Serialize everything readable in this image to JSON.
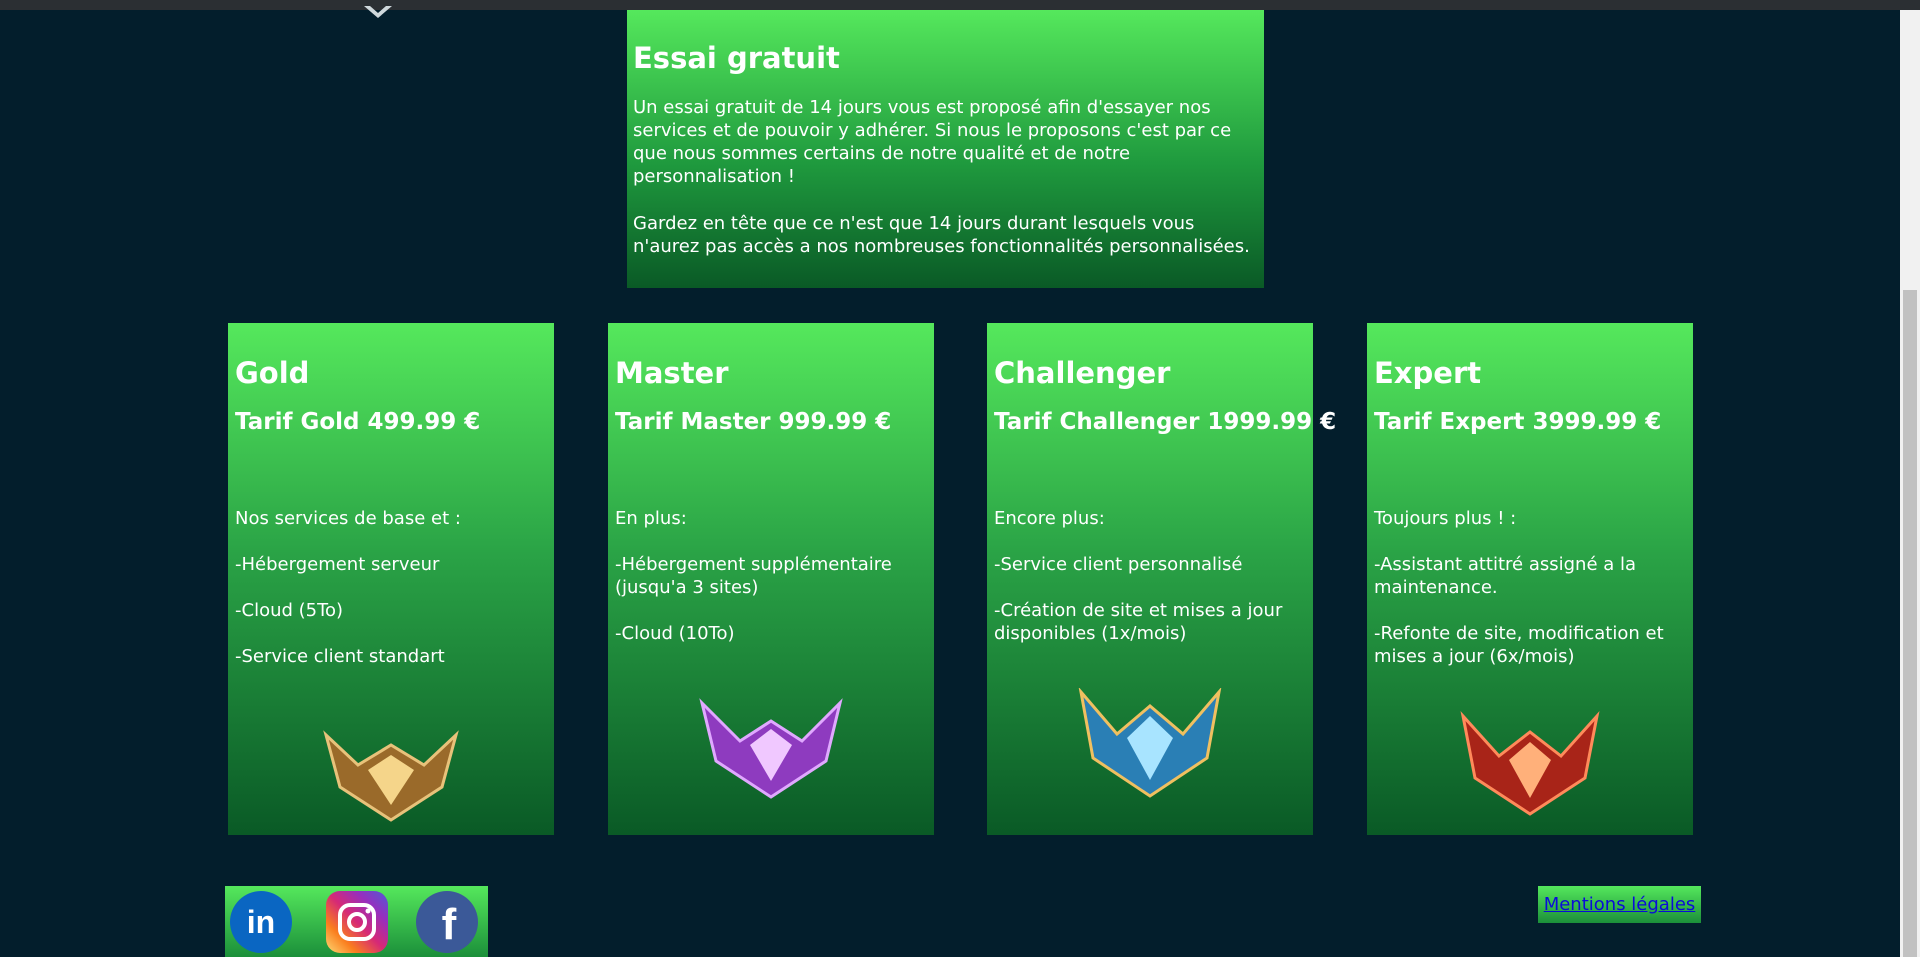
{
  "trial": {
    "title": "Essai gratuit",
    "paragraph1": "Un essai gratuit de 14 jours vous est proposé afin d'essayer nos services et de pouvoir y adhérer. Si nous le proposons c'est par ce que nous sommes certains de notre qualité et de notre personnalisation !",
    "paragraph2": "Gardez en tête que ce n'est que 14 jours durant lesquels vous n'aurez pas accès a nos nombreuses fonctionnalités personnalisées."
  },
  "plans": [
    {
      "name": "Gold",
      "price": "Tarif Gold 499.99 €",
      "intro": "Nos services de base et :",
      "features": [
        "-Hébergement serveur",
        "-Cloud (5To)",
        "-Service client standart"
      ],
      "emblem": "gold-rank-emblem",
      "color": "#b8853a"
    },
    {
      "name": "Master",
      "price": "Tarif Master 999.99 €",
      "intro": "En plus:",
      "features": [
        "-Hébergement supplémentaire (jusqu'a 3 sites)",
        "-Cloud (10To)"
      ],
      "emblem": "master-rank-emblem",
      "color": "#b55ce0"
    },
    {
      "name": "Challenger",
      "price": "Tarif Challenger 1999.99 €",
      "intro": "Encore plus:",
      "features": [
        "-Service client personnalisé",
        "-Création de site et mises a jour disponibles (1x/mois)"
      ],
      "emblem": "challenger-rank-emblem",
      "color": "#3fa9e0"
    },
    {
      "name": "Expert",
      "price": "Tarif Expert 3999.99 €",
      "intro": "Toujours plus ! :",
      "features": [
        "-Assistant attitré assigné a la maintenance.",
        "-Refonte de site, modification et mises a jour (6x/mois)"
      ],
      "emblem": "grandmaster-rank-emblem",
      "color": "#d63a2a"
    }
  ],
  "footer": {
    "social": [
      {
        "icon": "linkedin-icon",
        "label": "in",
        "color": "#0a66c2"
      },
      {
        "icon": "instagram-icon",
        "label": "",
        "color": "#e1306c"
      },
      {
        "icon": "facebook-icon",
        "label": "f",
        "color": "#3b5998"
      }
    ],
    "legal_link": "Mentions légales"
  }
}
